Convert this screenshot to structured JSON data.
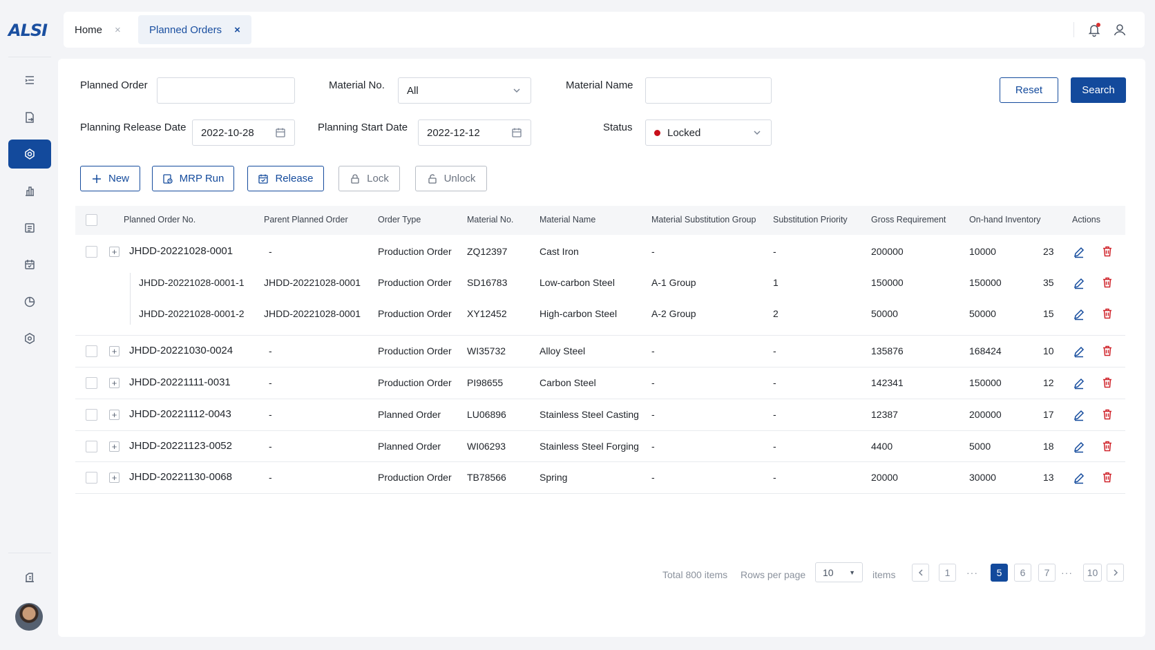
{
  "app": {
    "logo": "ALSI"
  },
  "tabs": [
    {
      "label": "Home",
      "close": "×"
    },
    {
      "label": "Planned Orders",
      "close": "×"
    }
  ],
  "filters": {
    "planned_order_label": "Planned Order",
    "planned_order_value": "",
    "material_no_label": "Material No.",
    "material_no_value": "All",
    "material_name_label": "Material Name",
    "material_name_value": "",
    "release_date_label": "Planning Release Date",
    "release_date_value": "2022-10-28",
    "start_date_label": "Planning Start Date",
    "start_date_value": "2022-12-12",
    "status_label": "Status",
    "status_value": "Locked",
    "reset": "Reset",
    "search": "Search"
  },
  "toolbar": {
    "new": "New",
    "mrp_run": "MRP Run",
    "release": "Release",
    "lock": "Lock",
    "unlock": "Unlock"
  },
  "table": {
    "headers": [
      "Planned Order No.",
      "Parent Planned Order",
      "Order Type",
      "Material No.",
      "Material Name",
      "Material Substitution Group",
      "Substitution Priority",
      "Gross Requirement",
      "On-hand Inventory",
      "Actions"
    ],
    "rows": [
      {
        "no": "JHDD-20221028-0001",
        "parent": "-",
        "type": "Production Order",
        "mat_no": "ZQ12397",
        "mat_name": "Cast Iron",
        "group": "-",
        "priority": "-",
        "gross": "200000",
        "onhand": "10000",
        "extra": "23"
      },
      {
        "no": "JHDD-20221028-0001-1",
        "parent": "JHDD-20221028-0001",
        "type": "Production Order",
        "mat_no": "SD16783",
        "mat_name": "Low-carbon Steel",
        "group": "A-1 Group",
        "priority": "1",
        "gross": "150000",
        "onhand": "150000",
        "extra": "35"
      },
      {
        "no": "JHDD-20221028-0001-2",
        "parent": "JHDD-20221028-0001",
        "type": "Production Order",
        "mat_no": "XY12452",
        "mat_name": "High-carbon Steel",
        "group": "A-2 Group",
        "priority": "2",
        "gross": "50000",
        "onhand": "50000",
        "extra": "15"
      },
      {
        "no": "JHDD-20221030-0024",
        "parent": "-",
        "type": "Production Order",
        "mat_no": "WI35732",
        "mat_name": "Alloy Steel",
        "group": "-",
        "priority": "-",
        "gross": "135876",
        "onhand": "168424",
        "extra": "10"
      },
      {
        "no": "JHDD-20221111-0031",
        "parent": "-",
        "type": "Production Order",
        "mat_no": "PI98655",
        "mat_name": "Carbon Steel",
        "group": "-",
        "priority": "-",
        "gross": "142341",
        "onhand": "150000",
        "extra": "12"
      },
      {
        "no": "JHDD-20221112-0043",
        "parent": "-",
        "type": "Planned Order",
        "mat_no": "LU06896",
        "mat_name": "Stainless Steel Casting",
        "group": "-",
        "priority": "-",
        "gross": "12387",
        "onhand": "200000",
        "extra": "17"
      },
      {
        "no": "JHDD-20221123-0052",
        "parent": "-",
        "type": "Planned Order",
        "mat_no": "WI06293",
        "mat_name": "Stainless Steel Forging",
        "group": "-",
        "priority": "-",
        "gross": "4400",
        "onhand": "5000",
        "extra": "18"
      },
      {
        "no": "JHDD-20221130-0068",
        "parent": "-",
        "type": "Production Order",
        "mat_no": "TB78566",
        "mat_name": "Spring",
        "group": "-",
        "priority": "-",
        "gross": "20000",
        "onhand": "30000",
        "extra": "13"
      }
    ]
  },
  "pagination": {
    "total": "Total 800 items",
    "rows_per_page": "Rows per page",
    "page_size": "10",
    "items": "items",
    "ellipsis": "···",
    "pages": [
      "1",
      "5",
      "6",
      "7",
      "10"
    ],
    "current": "5"
  },
  "colors": {
    "primary": "#134a9c",
    "danger": "#d0242b",
    "status_locked": "#c8101a"
  }
}
